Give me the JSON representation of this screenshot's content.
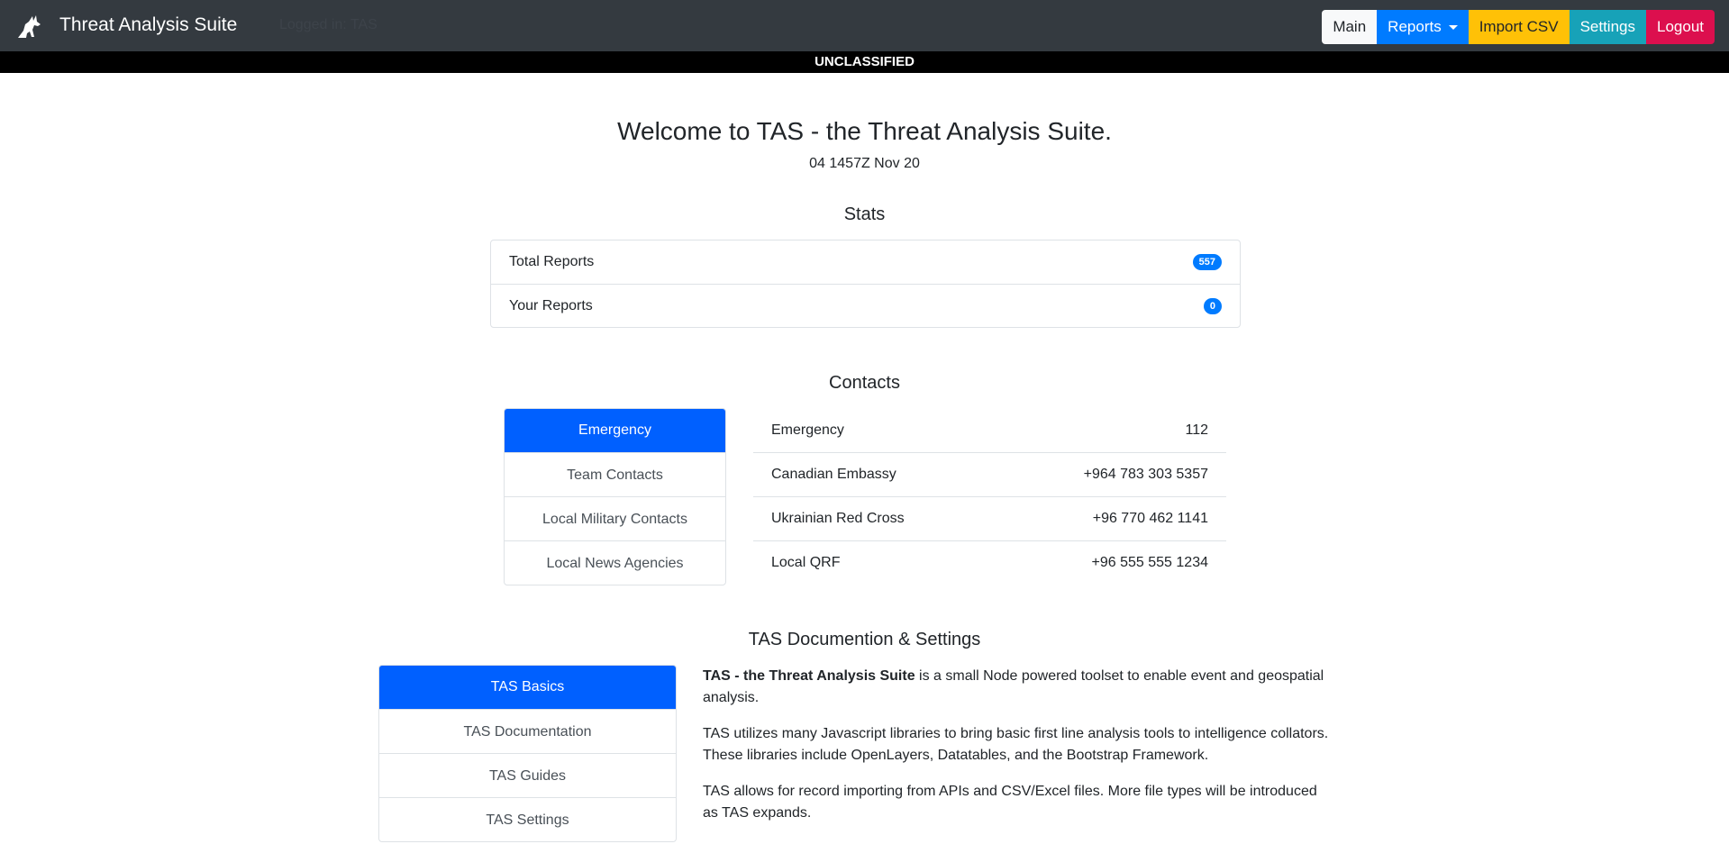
{
  "navbar": {
    "brand_title": "Threat Analysis Suite",
    "logged_in_text": "Logged in: TAS",
    "buttons": {
      "main": "Main",
      "reports": "Reports",
      "import_csv": "Import CSV",
      "settings": "Settings",
      "logout": "Logout"
    },
    "colors": {
      "navbar_bg": "#343a40",
      "reports": "#007bff",
      "import_csv": "#ffc107",
      "settings": "#17a2b8",
      "logout": "#dc0f4e"
    }
  },
  "classification": "UNCLASSIFIED",
  "welcome": {
    "title": "Welcome to TAS - the Threat Analysis Suite.",
    "datetime": "04 1457Z Nov 20"
  },
  "stats": {
    "heading": "Stats",
    "items": [
      {
        "label": "Total Reports",
        "count": "557"
      },
      {
        "label": "Your Reports",
        "count": "0"
      }
    ]
  },
  "contacts": {
    "heading": "Contacts",
    "tabs": [
      "Emergency",
      "Team Contacts",
      "Local Military Contacts",
      "Local News Agencies"
    ],
    "active_tab": "Emergency",
    "rows": [
      {
        "name": "Emergency",
        "number": "112"
      },
      {
        "name": "Canadian Embassy",
        "number": "+964 783 303 5357"
      },
      {
        "name": "Ukrainian Red Cross",
        "number": "+96 770 462 1141"
      },
      {
        "name": "Local QRF",
        "number": "+96 555 555 1234"
      }
    ]
  },
  "docs": {
    "heading": "TAS Documention & Settings",
    "tabs": [
      "TAS Basics",
      "TAS Documentation",
      "TAS Guides",
      "TAS Settings"
    ],
    "active_tab": "TAS Basics",
    "p1_strong": "TAS - the Threat Analysis Suite",
    "p1_rest": " is a small Node powered toolset to enable event and geospatial analysis.",
    "p2": "TAS utilizes many Javascript libraries to bring basic first line analysis tools to intelligence collators. These libraries include OpenLayers, Datatables, and the Bootstrap Framework.",
    "p3": "TAS allows for record importing from APIs and CSV/Excel files. More file types will be introduced as TAS expands."
  },
  "accent_color": "#0060ff"
}
